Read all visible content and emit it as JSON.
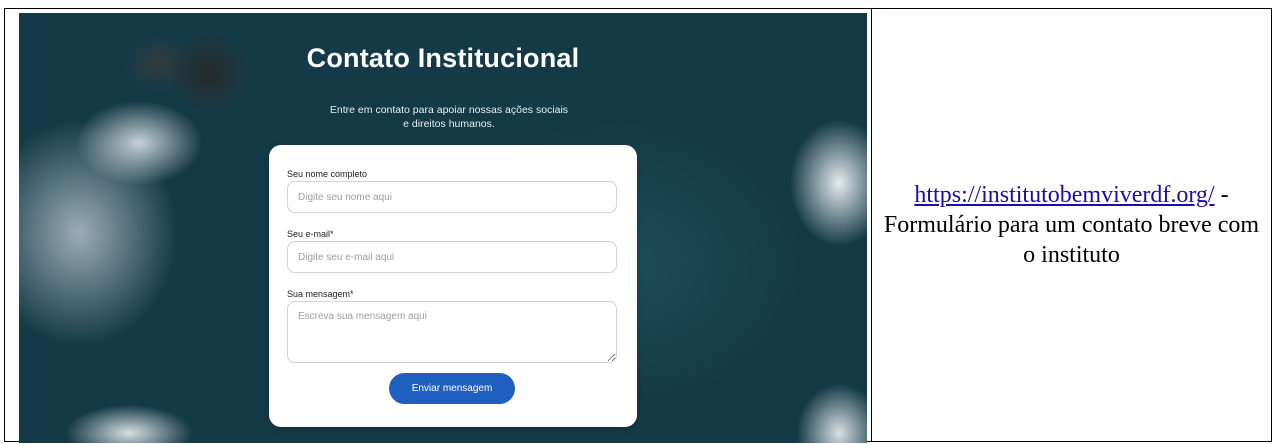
{
  "form": {
    "title": "Contato Institucional",
    "subtitle": "Entre em contato para apoiar nossas ações sociais e direitos humanos.",
    "name_label": "Seu nome completo",
    "name_placeholder": "Digite seu nome aqui",
    "email_label": "Seu e-mail*",
    "email_placeholder": "Digite seu e-mail aqui",
    "message_label": "Sua mensagem*",
    "message_placeholder": "Escreva sua mensagem aqui",
    "submit_label": "Enviar mensagem"
  },
  "caption": {
    "link": "https://institutobemviverdf.org/",
    "text": " - Formulário para um contato breve com o instituto"
  },
  "colors": {
    "button": "#1f5fbf",
    "link": "#1a0dab"
  }
}
